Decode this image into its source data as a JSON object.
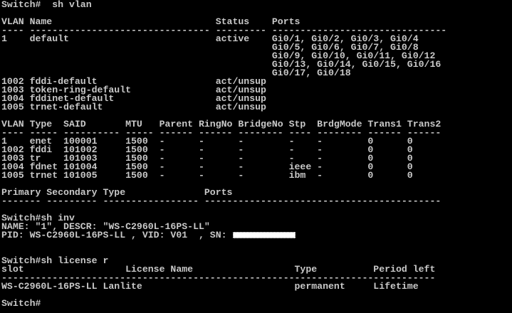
{
  "colors": {
    "background": "#000000",
    "text": "#c8c8c8",
    "redaction": "#ffffff"
  },
  "terminal": {
    "lines": [
      "Switch#  sh vlan",
      "",
      "VLAN Name                             Status    Ports",
      "---- -------------------------------- --------- -------------------------------",
      "1    default                          active    Gi0/1, Gi0/2, Gi0/3, Gi0/4",
      "                                                Gi0/5, Gi0/6, Gi0/7, Gi0/8",
      "                                                Gi0/9, Gi0/10, Gi0/11, Gi0/12",
      "                                                Gi0/13, Gi0/14, Gi0/15, Gi0/16",
      "                                                Gi0/17, Gi0/18",
      "1002 fddi-default                     act/unsup",
      "1003 token-ring-default               act/unsup",
      "1004 fddinet-default                  act/unsup",
      "1005 trnet-default                    act/unsup",
      "",
      "VLAN Type  SAID       MTU   Parent RingNo BridgeNo Stp  BrdgMode Trans1 Trans2",
      "---- ----- ---------- ----- ------ ------ -------- ---- -------- ------ ------",
      "1    enet  100001     1500  -      -      -        -    -        0      0",
      "1002 fddi  101002     1500  -      -      -        -    -        0      0",
      "1003 tr    101003     1500  -      -      -        -    -        0      0",
      "1004 fdnet 101004     1500  -      -      -        ieee -        0      0",
      "1005 trnet 101005     1500  -      -      -        ibm  -        0      0",
      "",
      "Primary Secondary Type              Ports",
      "------- --------- ----------------- ------------------------------------------",
      "",
      "Switch#sh inv",
      "NAME: \"1\", DESCR: \"WS-C2960L-16PS-LL\"",
      "PID: WS-C2960L-16PS-LL , VID: V01  , SN: ",
      "",
      "",
      "Switch#sh license r",
      "slot                  License Name                  Type          Period left",
      "-----------------------------------------------------------------------------",
      "WS-C2960L-16PS-LL Lanlite                           permanent     Lifetime",
      "",
      "Switch#"
    ]
  }
}
